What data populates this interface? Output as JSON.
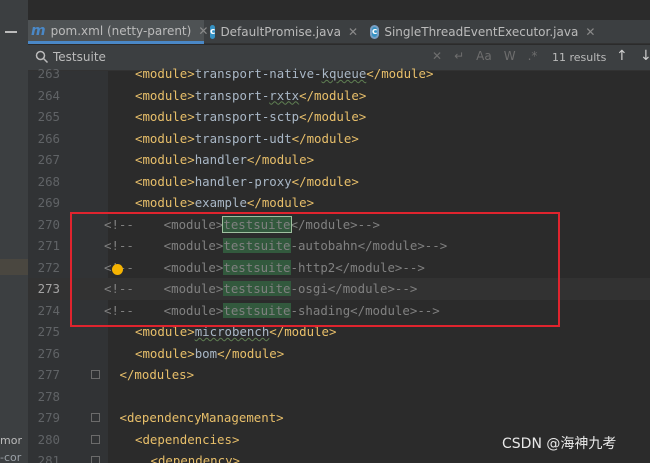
{
  "left_panel": {
    "frag1": "mor",
    "frag2": "-cor"
  },
  "tabs": [
    {
      "label": "pom.xml (netty-parent)",
      "icon": "m",
      "active": true
    },
    {
      "label": "DefaultPromise.java",
      "icon": "c",
      "active": false
    },
    {
      "label": "SingleThreadEventExecutor.java",
      "icon": "i",
      "active": false
    }
  ],
  "search": {
    "query": "Testsuite",
    "option_words": "Aa",
    "option_regex_w": "W",
    "option_regex": ".*",
    "results": "11 results"
  },
  "lines": [
    {
      "num": "263",
      "text": "<module>transport-native-kqueue</module>"
    },
    {
      "num": "264",
      "text": "<module>transport-rxtx</module>"
    },
    {
      "num": "265",
      "text": "<module>transport-sctp</module>"
    },
    {
      "num": "266",
      "text": "<module>transport-udt</module>"
    },
    {
      "num": "267",
      "text": "<module>handler</module>"
    },
    {
      "num": "268",
      "text": "<module>handler-proxy</module>"
    },
    {
      "num": "269",
      "text": "<module>example</module>"
    },
    {
      "num": "270",
      "text": "<!--    <module>testsuite</module>-->"
    },
    {
      "num": "271",
      "text": "<!--    <module>testsuite-autobahn</module>-->"
    },
    {
      "num": "272",
      "text": "<!--    <module>testsuite-http2</module>-->"
    },
    {
      "num": "273",
      "text": "<!--    <module>testsuite-osgi</module>-->"
    },
    {
      "num": "274",
      "text": "<!--    <module>testsuite-shading</module>-->"
    },
    {
      "num": "275",
      "text": "<module>microbench</module>"
    },
    {
      "num": "276",
      "text": "<module>bom</module>"
    },
    {
      "num": "277",
      "text": "</modules>"
    },
    {
      "num": "278",
      "text": ""
    },
    {
      "num": "279",
      "text": "<dependencyManagement>"
    },
    {
      "num": "280",
      "text": "<dependencies>"
    },
    {
      "num": "281",
      "text": "<dependency>"
    }
  ],
  "current_line": "273",
  "watermark": "CSDN @海神九考",
  "colors": {
    "accent": "#4a88c7",
    "highlight": "#32593d",
    "annotation": "#e0242e"
  }
}
